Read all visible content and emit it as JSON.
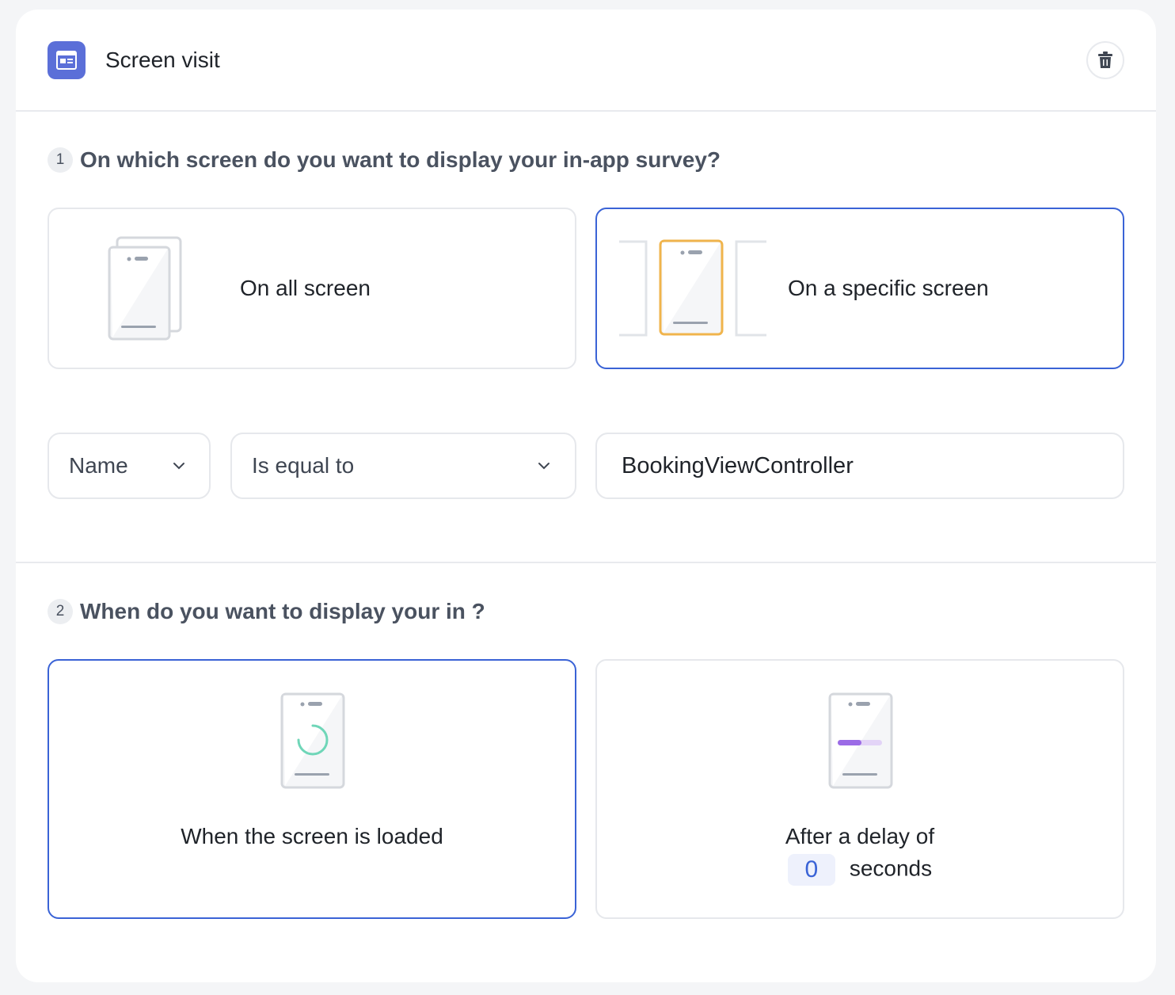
{
  "header": {
    "title": "Screen visit",
    "icon": "screen-window-icon",
    "delete_icon": "trash-icon",
    "accent": "#5b6fd8"
  },
  "step1": {
    "number": "1",
    "question": "On which screen do you want to display your in-app survey?",
    "options": [
      {
        "label": "On all screen",
        "icon": "stacked-phones-icon",
        "selected": false
      },
      {
        "label": "On a specific screen",
        "icon": "single-phone-highlight-icon",
        "selected": true
      }
    ]
  },
  "filter": {
    "field": "Name",
    "operator": "Is equal to",
    "value": "BookingViewController"
  },
  "step2": {
    "number": "2",
    "question": "When do you want to display your in ?",
    "options": [
      {
        "label": "When the screen is loaded",
        "icon": "phone-loading-icon",
        "selected": true
      },
      {
        "label": "After a delay of",
        "icon": "phone-progress-icon",
        "selected": false,
        "delay_value": "0",
        "delay_unit": "seconds"
      }
    ]
  },
  "colors": {
    "selected_border": "#3a63d6",
    "highlight_phone": "#f0b44c",
    "spinner": "#6fd6b8",
    "progress": "#9b6be6"
  }
}
